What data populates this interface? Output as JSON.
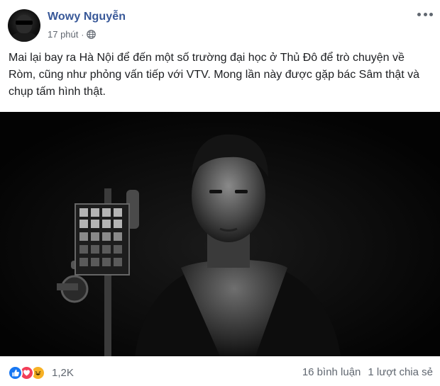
{
  "post": {
    "author": "Wowy Nguyễn",
    "time": "17 phút",
    "separator": "·",
    "privacy_icon": "globe-icon",
    "more_icon": "more-options-icon",
    "text": "Mai lại bay ra Hà Nội để đến một số trường đại học ở Thủ Đô để trò chuyện về Ròm, cũng như phỏng vấn tiếp với VTV. Mong lần này được gặp bác Sâm thật và chụp tấm hình thật."
  },
  "footer": {
    "reactions": [
      "like-icon",
      "love-icon",
      "haha-icon"
    ],
    "reaction_count": "1,2K",
    "comments": "16 bình luận",
    "shares": "1 lượt chia sẻ"
  },
  "colors": {
    "author": "#385898",
    "like": "#1877f2",
    "love": "#f33e58",
    "haha": "#f7b125",
    "muted": "#606770"
  }
}
